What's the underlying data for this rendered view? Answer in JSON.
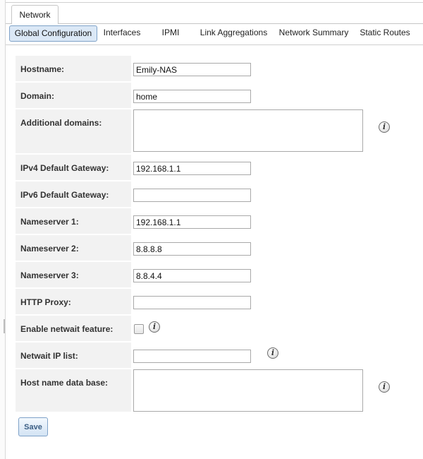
{
  "outer_tab": {
    "label": "Network"
  },
  "tabs": [
    {
      "label": "Global Configuration",
      "active": true
    },
    {
      "label": "Interfaces"
    },
    {
      "label": "IPMI"
    },
    {
      "label": "Link Aggregations"
    },
    {
      "label": "Network Summary"
    },
    {
      "label": "Static Routes"
    }
  ],
  "form": {
    "hostname": {
      "label": "Hostname:",
      "value": "Emily-NAS"
    },
    "domain": {
      "label": "Domain:",
      "value": "home"
    },
    "additional_domains": {
      "label": "Additional domains:",
      "value": ""
    },
    "ipv4_gateway": {
      "label": "IPv4 Default Gateway:",
      "value": "192.168.1.1"
    },
    "ipv6_gateway": {
      "label": "IPv6 Default Gateway:",
      "value": ""
    },
    "nameserver1": {
      "label": "Nameserver 1:",
      "value": "192.168.1.1"
    },
    "nameserver2": {
      "label": "Nameserver 2:",
      "value": "8.8.8.8"
    },
    "nameserver3": {
      "label": "Nameserver 3:",
      "value": "8.8.4.4"
    },
    "http_proxy": {
      "label": "HTTP Proxy:",
      "value": ""
    },
    "netwait": {
      "label": "Enable netwait feature:",
      "checked": false
    },
    "netwait_ip_list": {
      "label": "Netwait IP list:",
      "value": ""
    },
    "hostname_db": {
      "label": "Host name data base:",
      "value": ""
    }
  },
  "icons": {
    "info": "info-icon",
    "info_glyph": "i"
  },
  "actions": {
    "save_label": "Save"
  }
}
